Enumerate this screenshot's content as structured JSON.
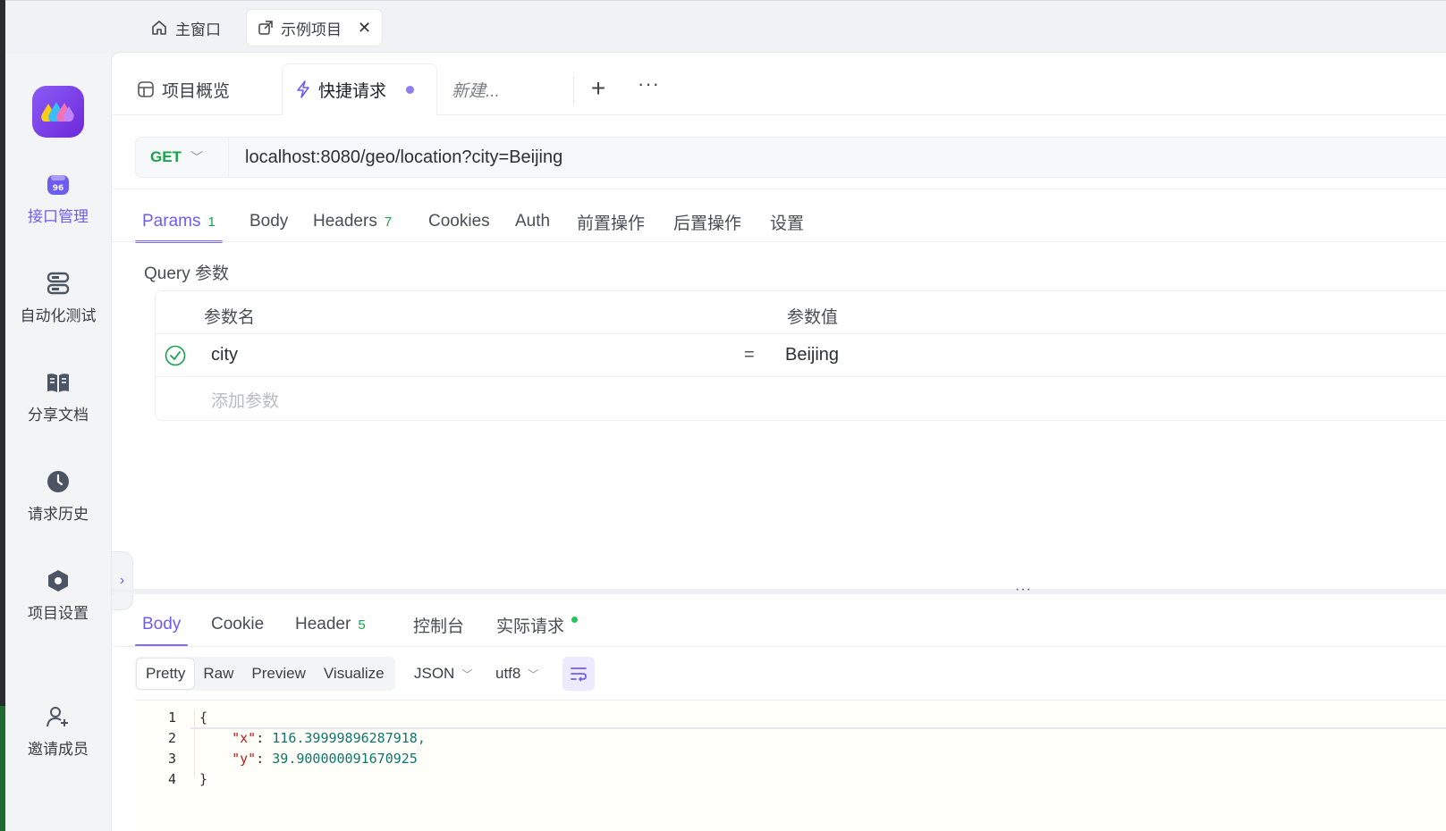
{
  "window_tabs": {
    "home_label": "主窗口",
    "project_label": "示例项目",
    "close_glyph": "✕"
  },
  "sidebar": {
    "items": [
      {
        "label": "接口管理",
        "icon": "api-management-icon"
      },
      {
        "label": "自动化测试",
        "icon": "automation-test-icon"
      },
      {
        "label": "分享文档",
        "icon": "book-icon"
      },
      {
        "label": "请求历史",
        "icon": "clock-icon"
      },
      {
        "label": "项目设置",
        "icon": "settings-hex-icon"
      },
      {
        "label": "邀请成员",
        "icon": "add-user-icon"
      }
    ],
    "api_badge": "96"
  },
  "page_tabs": {
    "overview": "项目概览",
    "quick": "快捷请求",
    "new": "新建...",
    "plus": "+",
    "more": "···"
  },
  "request": {
    "method": "GET",
    "url": "localhost:8080/geo/location?city=Beijing"
  },
  "request_tabs": [
    {
      "label": "Params",
      "badge": "1"
    },
    {
      "label": "Body",
      "badge": ""
    },
    {
      "label": "Headers",
      "badge": "7"
    },
    {
      "label": "Cookies",
      "badge": ""
    },
    {
      "label": "Auth",
      "badge": ""
    },
    {
      "label": "前置操作",
      "badge": ""
    },
    {
      "label": "后置操作",
      "badge": ""
    },
    {
      "label": "设置",
      "badge": ""
    }
  ],
  "query": {
    "section_label": "Query 参数",
    "col_name": "参数名",
    "col_value": "参数值",
    "rows": [
      {
        "name": "city",
        "eq": "=",
        "value": "Beijing",
        "enabled": true
      }
    ],
    "add_placeholder": "添加参数"
  },
  "response_tabs": [
    {
      "label": "Body",
      "badge": ""
    },
    {
      "label": "Cookie",
      "badge": ""
    },
    {
      "label": "Header",
      "badge": "5"
    },
    {
      "label": "控制台",
      "badge": ""
    },
    {
      "label": "实际请求",
      "badge": ""
    }
  ],
  "format": {
    "views": [
      "Pretty",
      "Raw",
      "Preview",
      "Visualize"
    ],
    "active_view": "Pretty",
    "type": "JSON",
    "encoding": "utf8"
  },
  "response_body": {
    "line_numbers": [
      "1",
      "2",
      "3",
      "4"
    ],
    "open_brace": "{",
    "close_brace": "}",
    "x_key": "\"x\"",
    "x_value": "116.39999896287918,",
    "y_key": "\"y\"",
    "y_value": "39.900000091670925",
    "colon": ": "
  },
  "colors": {
    "accent": "#6d5cf0",
    "method_get": "#16a34a",
    "badge": "#16a34a"
  }
}
